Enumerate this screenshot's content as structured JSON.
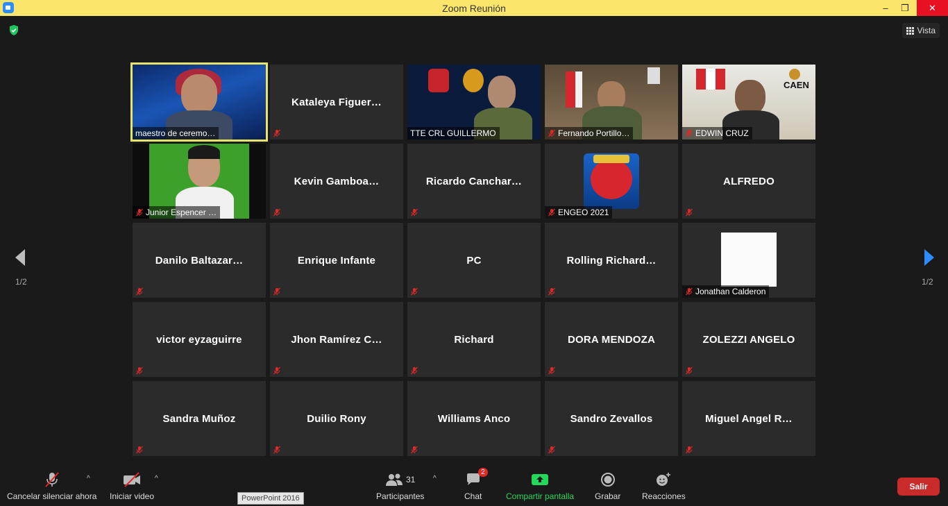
{
  "window": {
    "title": "Zoom Reunión"
  },
  "topbar": {
    "view_label": "Vista"
  },
  "tiles": [
    {
      "name": "maestro de ceremo…",
      "video": true
    },
    {
      "name": "Kataleya  Figuer…",
      "video": false
    },
    {
      "name": "TTE CRL GUILLERMO",
      "video": true
    },
    {
      "name": "Fernando Portillo…",
      "video": true
    },
    {
      "name": "EDWIN CRUZ",
      "video": true
    },
    {
      "name": "Junior Espencer …",
      "video": true
    },
    {
      "name": "Kevin  Gamboa…",
      "video": false
    },
    {
      "name": "Ricardo  Canchar…",
      "video": false
    },
    {
      "name": "ENGEO 2021",
      "video": true
    },
    {
      "name": "ALFREDO",
      "video": false
    },
    {
      "name": "Danilo  Baltazar…",
      "video": false
    },
    {
      "name": "Enrique Infante",
      "video": false
    },
    {
      "name": "PC",
      "video": false
    },
    {
      "name": "Rolling  Richard…",
      "video": false
    },
    {
      "name": "Jonathan Calderon",
      "video": true
    },
    {
      "name": "victor eyzaguirre",
      "video": false
    },
    {
      "name": "Jhon  Ramírez  C…",
      "video": false
    },
    {
      "name": "Richard",
      "video": false
    },
    {
      "name": "DORA MENDOZA",
      "video": false
    },
    {
      "name": "ZOLEZZI ANGELO",
      "video": false
    },
    {
      "name": "Sandra Muñoz",
      "video": false
    },
    {
      "name": "Duilio Rony",
      "video": false
    },
    {
      "name": "Williams Anco",
      "video": false
    },
    {
      "name": "Sandro Zevallos",
      "video": false
    },
    {
      "name": "Miguel  Angel  R…",
      "video": false
    }
  ],
  "video_overlays": {
    "caen_logo": "CAEN"
  },
  "pager": {
    "left": "1/2",
    "right": "1/2"
  },
  "toolbar": {
    "mute_label": "Cancelar silenciar ahora",
    "video_label": "Iniciar video",
    "participants_label": "Participantes",
    "participants_count": "31",
    "chat_label": "Chat",
    "chat_badge": "2",
    "share_label": "Compartir pantalla",
    "record_label": "Grabar",
    "reactions_label": "Reacciones",
    "leave_label": "Salir",
    "tooltip": "PowerPoint 2016"
  },
  "colors": {
    "active_speaker": "#e8e36b",
    "share_green": "#23d959",
    "leave_red": "#c92a2a",
    "titlebar": "#fbe56b",
    "nav_blue": "#2d8cff"
  }
}
